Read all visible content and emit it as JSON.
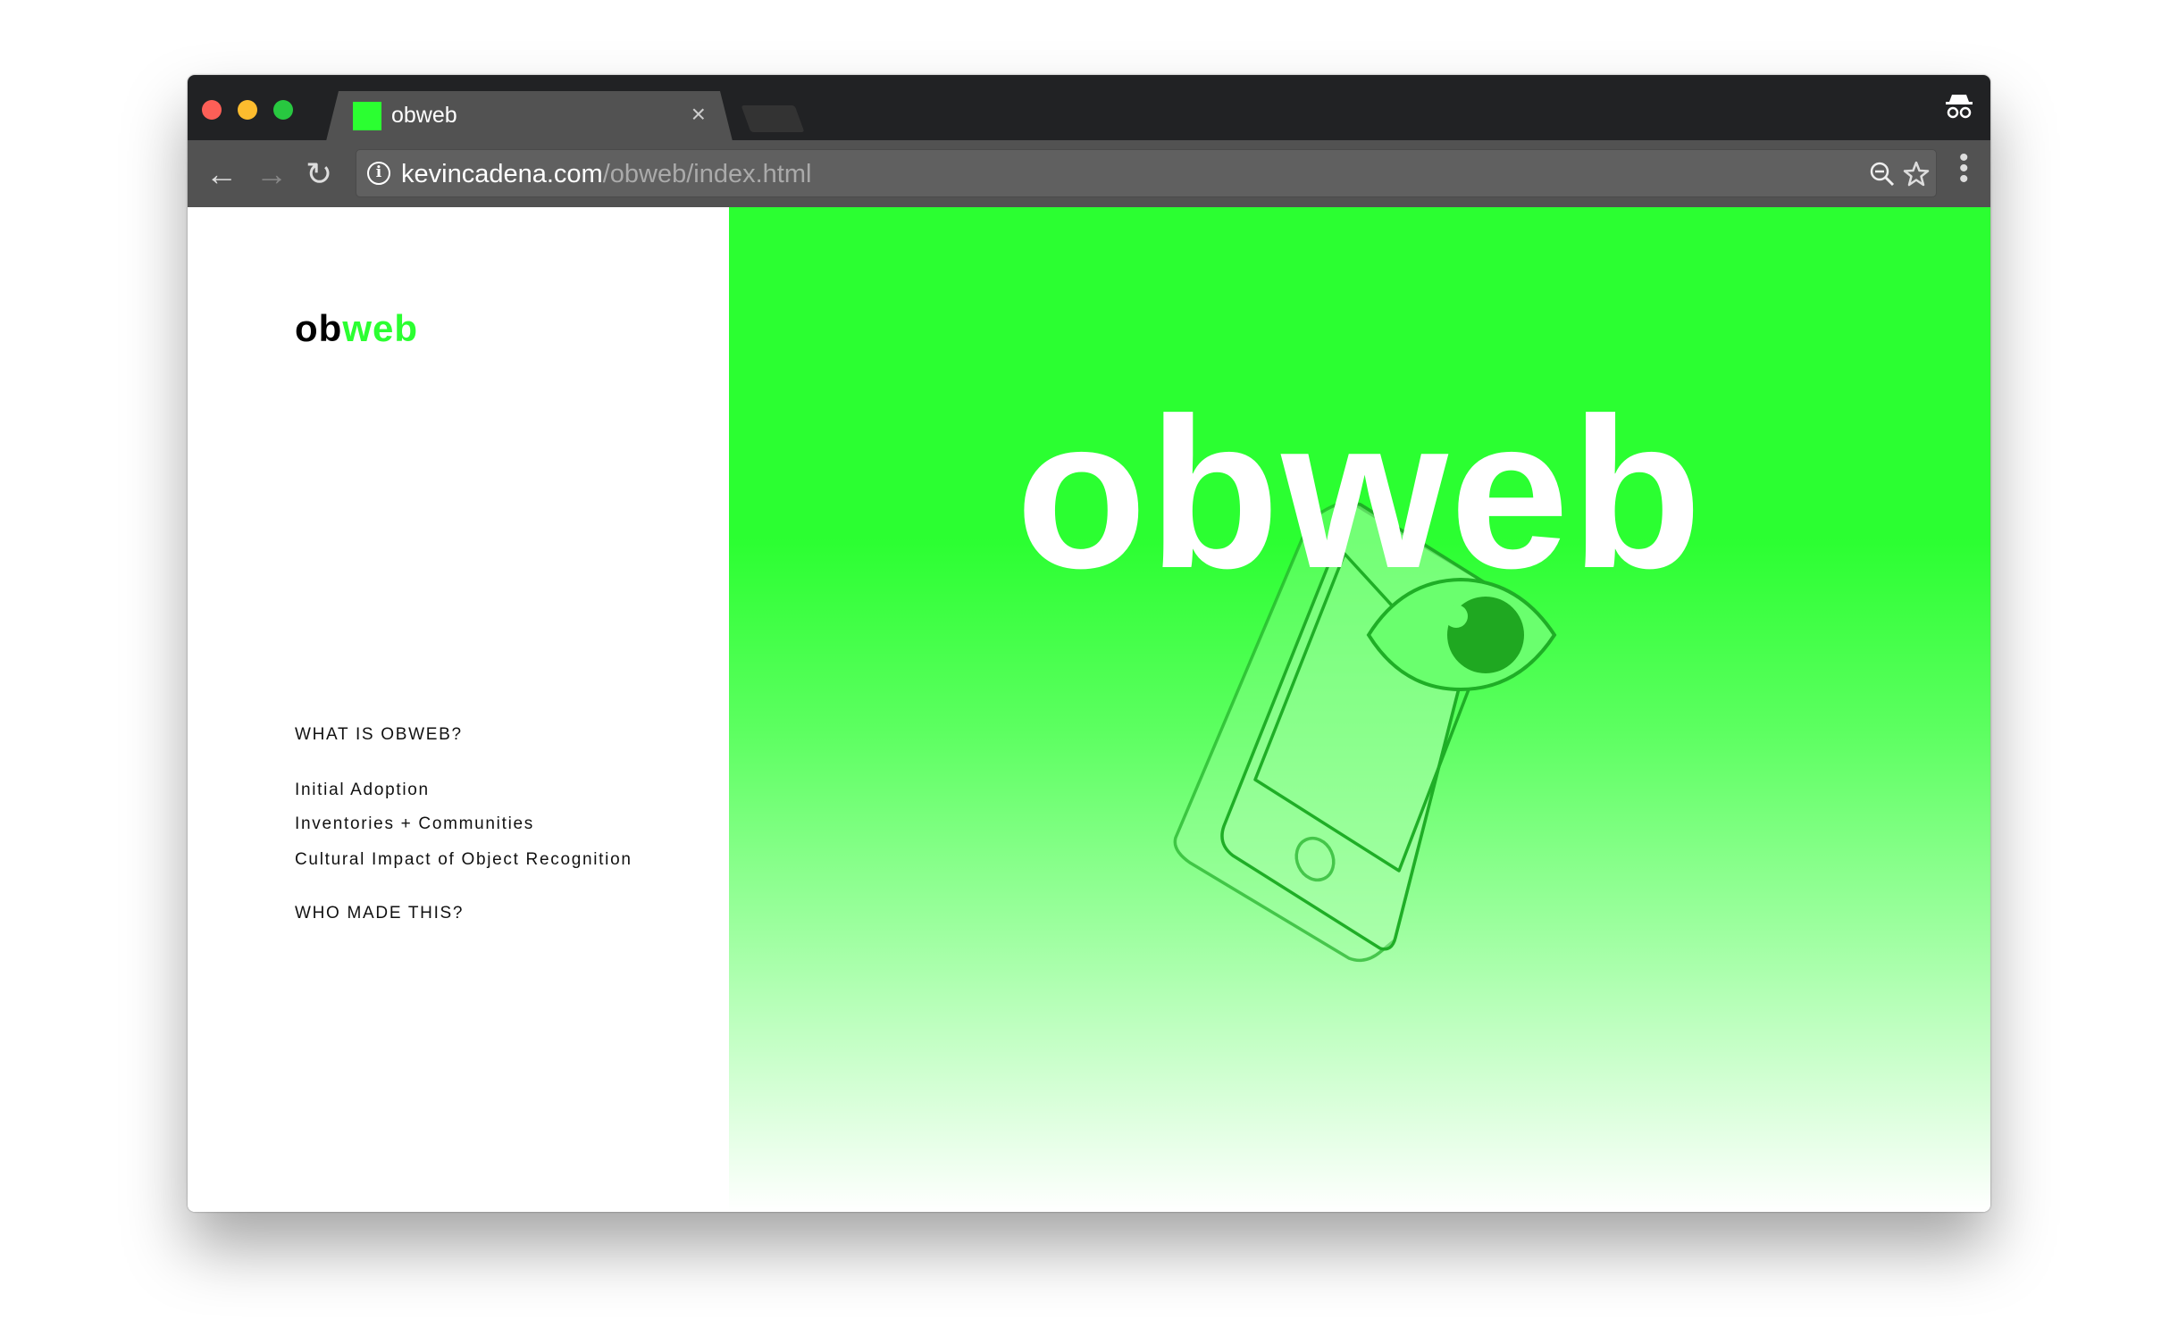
{
  "browser": {
    "tab_title": "obweb",
    "tab_close": "×",
    "url_domain": "kevincadena.com",
    "url_path": "/obweb/index.html",
    "colors": {
      "favicon": "#2bff31"
    }
  },
  "sidebar": {
    "logo_black": "ob",
    "logo_green": "web",
    "links": [
      {
        "label": "WHAT IS OBWEB?"
      },
      {
        "label": "Initial Adoption"
      },
      {
        "label": "Inventories + Communities"
      },
      {
        "label": "Cultural Impact of Object Recognition"
      },
      {
        "label": "WHO MADE THIS?"
      }
    ]
  },
  "hero": {
    "title": "obweb",
    "illustration": "phone-with-eye",
    "colors": {
      "accent": "#2bff31"
    }
  }
}
